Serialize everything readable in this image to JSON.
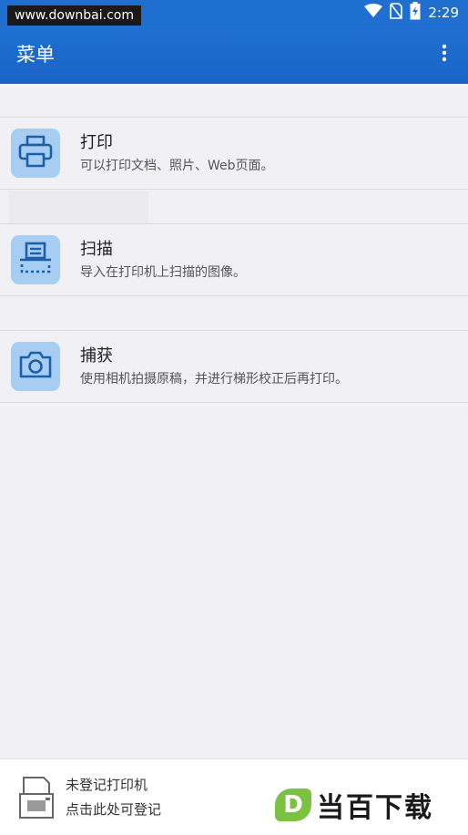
{
  "status_bar": {
    "watermark": "www.downbai.com",
    "time": "2:29",
    "icons": [
      "wifi-icon",
      "no-sim-icon",
      "battery-charging-icon"
    ]
  },
  "app_bar": {
    "title": "菜单",
    "menu_icon": "more-vert-icon"
  },
  "menu": {
    "items": [
      {
        "icon": "printer-icon",
        "title": "打印",
        "desc": "可以打印文档、照片、Web页面。"
      },
      {
        "icon": "scanner-icon",
        "title": "扫描",
        "desc": "导入在打印机上扫描的图像。"
      },
      {
        "icon": "camera-icon",
        "title": "捕获",
        "desc": "使用相机拍摄原稿，并进行梯形校正后再打印。"
      }
    ]
  },
  "bottom_bar": {
    "icon": "printer-outline-icon",
    "line1": "未登记打印机",
    "line2": "点击此处可登记",
    "brand_letter": "D",
    "brand_text": "当百下载"
  },
  "colors": {
    "app_bar": "#1f70d2",
    "icon_tile": "#a7cdf3",
    "icon_stroke": "#1d5fa8",
    "background": "#f1f0f5",
    "brand_green": "#7cc242"
  }
}
